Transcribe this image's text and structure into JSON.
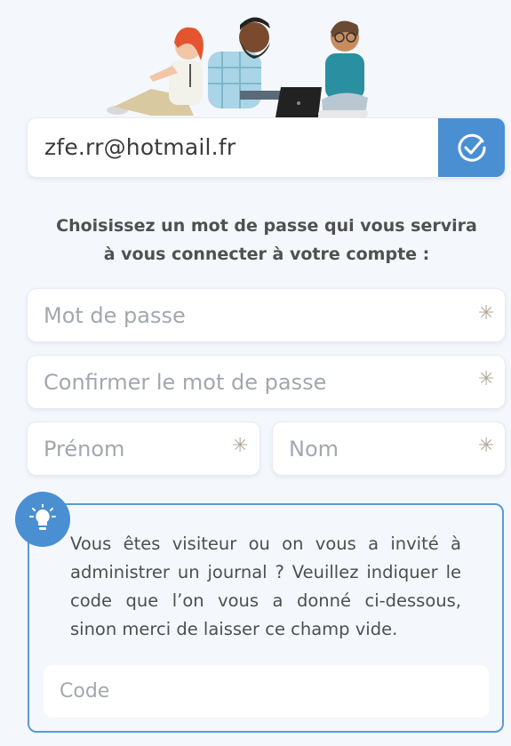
{
  "email": {
    "value": "zfe.rr@hotmail.fr"
  },
  "instruction": {
    "line1": "Choisissez un mot de passe qui vous servira",
    "line2": "à vous connecter à votre compte :"
  },
  "form": {
    "password_placeholder": "Mot de passe",
    "confirm_placeholder": "Confirmer le mot de passe",
    "firstname_placeholder": "Prénom",
    "lastname_placeholder": "Nom",
    "required_marker": "✳"
  },
  "info": {
    "text": "Vous êtes visiteur ou on vous a invité à administrer un journal ? Veuillez indiquer le code que l’on vous a donné ci-dessous, sinon merci de laisser ce champ vide.",
    "code_placeholder": "Code"
  },
  "colors": {
    "accent": "#4a8fd2",
    "border": "#5b9ad6",
    "background": "#f4f7fb"
  },
  "icons": {
    "verify": "check-circle-icon",
    "info": "lightbulb-icon"
  }
}
